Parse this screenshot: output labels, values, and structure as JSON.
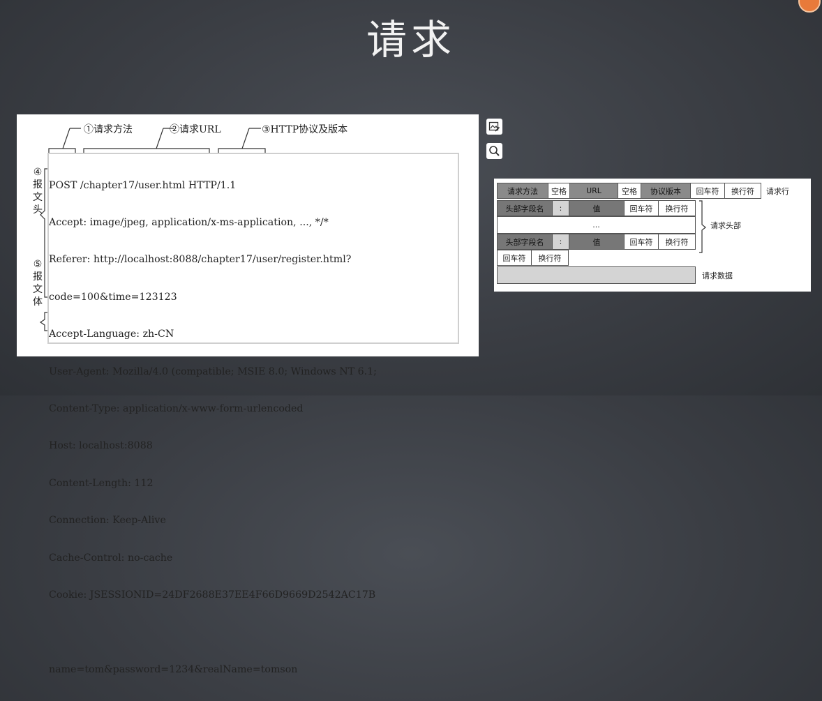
{
  "slide": {
    "title": "请求"
  },
  "left": {
    "callouts": {
      "method": "①请求方法",
      "url": "②请求URL",
      "protocol": "③HTTP协议及版本",
      "headers": [
        "④",
        "报",
        "文",
        "头"
      ],
      "body": [
        "⑤",
        "报",
        "文",
        "体"
      ]
    },
    "lines": [
      "POST /chapter17/user.html HTTP/1.1",
      "Accept: image/jpeg, application/x-ms-application, ..., */*",
      "Referer: http://localhost:8088/chapter17/user/register.html?",
      "code=100&time=123123",
      "Accept-Language: zh-CN",
      "User-Agent: Mozilla/4.0 (compatible; MSIE 8.0; Windows NT 6.1;",
      "Content-Type: application/x-www-form-urlencoded",
      "Host: localhost:8088",
      "Content-Length: 112",
      "Connection: Keep-Alive",
      "Cache-Control: no-cache",
      "Cookie: JSESSIONID=24DF2688E37EE4F66D9669D2542AC17B"
    ],
    "body_line": "name=tom&password=1234&realName=tomson"
  },
  "icons": {
    "edit": "image-edit-icon",
    "zoom": "zoom-icon"
  },
  "right": {
    "row1": {
      "method": "请求方法",
      "space1": "空格",
      "url": "URL",
      "space2": "空格",
      "version": "协议版本",
      "cr": "回车符",
      "lf": "换行符",
      "label": "请求行"
    },
    "header_row": {
      "field": "头部字段名",
      "colon": ":",
      "value": "值",
      "cr": "回车符",
      "lf": "换行符"
    },
    "ellipsis": "...",
    "headers_label": "请求头部",
    "blank_row": {
      "cr": "回车符",
      "lf": "换行符"
    },
    "data_label": "请求数据"
  }
}
